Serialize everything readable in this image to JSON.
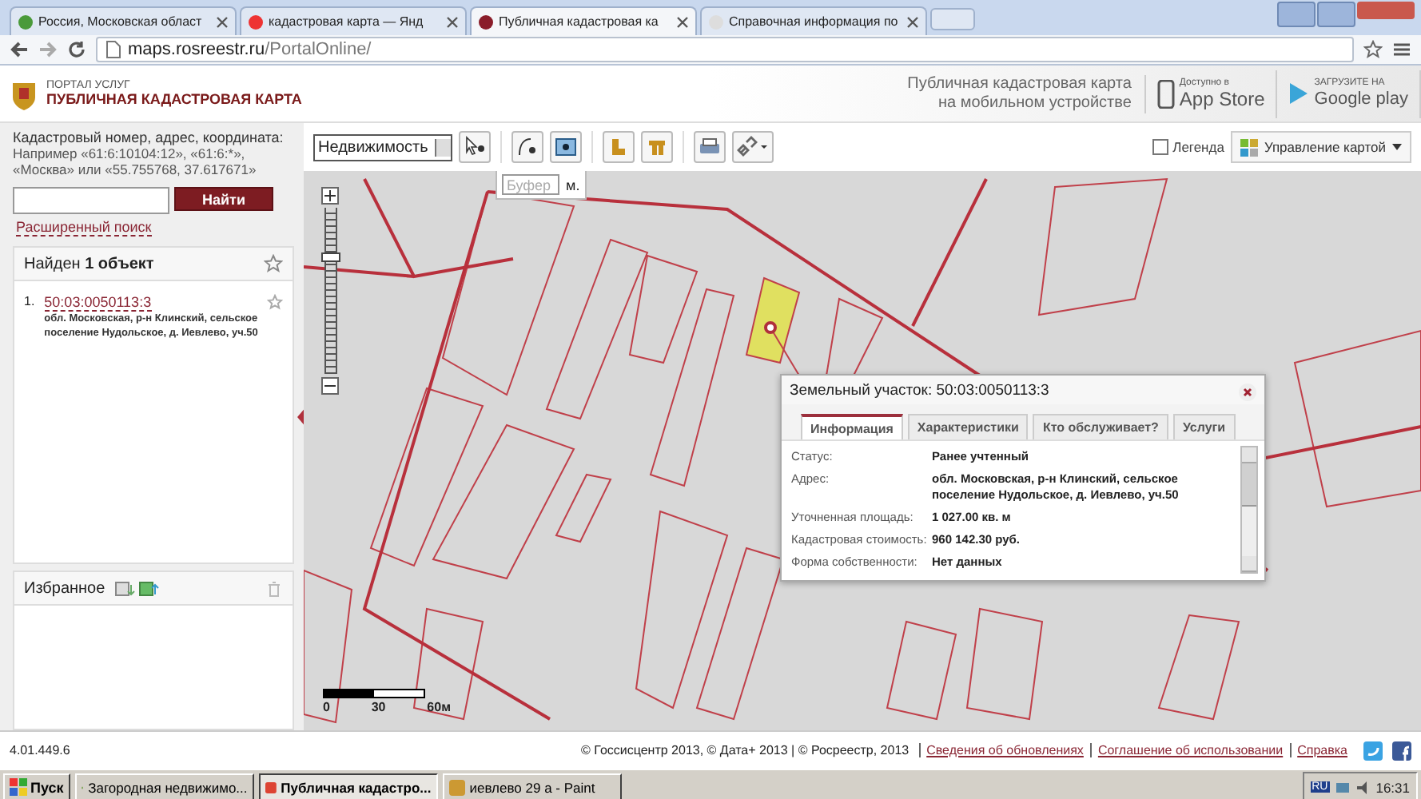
{
  "browser": {
    "tabs": [
      {
        "title": "Россия, Московская област",
        "selected": false
      },
      {
        "title": "кадастровая карта — Янд",
        "selected": false
      },
      {
        "title": "Публичная кадастровая ка",
        "selected": true
      },
      {
        "title": "Справочная информация по",
        "selected": false
      }
    ],
    "url_host": "maps.rosreestr.ru",
    "url_path": "/PortalOnline/"
  },
  "header": {
    "portal": "ПОРТАЛ УСЛУГ",
    "title": "ПУБЛИЧНАЯ КАДАСТРОВАЯ КАРТА",
    "promo": "Публичная кадастровая карта на мобильном устройстве",
    "app_store": {
      "caption": "Доступно в",
      "name": "App Store"
    },
    "google_play": {
      "caption": "ЗАГРУЗИТЕ НА",
      "name": "Google play"
    }
  },
  "search": {
    "label": "Кадастровый номер, адрес, координата:",
    "hint": "Например «61:6:10104:12», «61:6:*», «Москва» или «55.755768, 37.617671»",
    "button": "Найти",
    "advanced": "Расширенный поиск"
  },
  "results": {
    "heading": "Найден **1 объект**",
    "items": [
      {
        "number": "1.",
        "id": "50:03:0050113:3",
        "address": "обл. Московская, р-н Клинский, сельское поселение Нудольское, д. Иевлево, уч.50"
      }
    ]
  },
  "favorites": {
    "heading": "Избранное"
  },
  "toolbar": {
    "layer_select": "Недвижимость",
    "buffer_placeholder": "Буфер",
    "buffer_unit": "м.",
    "legend": {
      "label": "Легенда",
      "checked": false
    },
    "map_control": "Управление картой"
  },
  "map": {
    "zoom": {
      "level": 0.72
    },
    "scale": [
      "0",
      "30",
      "60м"
    ],
    "popup": {
      "title": "Земельный участок: 50:03:0050113:3",
      "tabs": [
        {
          "label": "Информация",
          "selected": true
        },
        {
          "label": "Характеристики",
          "selected": false
        },
        {
          "label": "Кто обслуживает?",
          "selected": false
        },
        {
          "label": "Услуги",
          "selected": false
        }
      ],
      "rows": [
        {
          "label": "Статус:",
          "value": "Ранее учтенный"
        },
        {
          "label": "Адрес:",
          "value": "обл. Московская, р-н Клинский, сельское поселение Нудольское, д. Иевлево, уч.50"
        },
        {
          "label": "Уточненная площадь:",
          "value": "1 027.00 кв. м"
        },
        {
          "label": "Кадастровая стоимость:",
          "value": "960 142.30 руб."
        },
        {
          "label": "Форма собственности:",
          "value": "Нет данных"
        }
      ]
    }
  },
  "footer": {
    "version": "4.01.449.6",
    "copyright": "© Госсисцентр 2013, © Дата+ 2013 | © Росреестр, 2013",
    "links": [
      "Сведения об обновлениях",
      "Соглашение об использовании",
      "Справка"
    ]
  },
  "taskbar": {
    "start": "Пуск",
    "items": [
      {
        "title": "Загородная недвижимо...",
        "selected": false
      },
      {
        "title": "Публичная кадастро...",
        "selected": true
      },
      {
        "title": "иевлево 29 а - Paint",
        "selected": false
      }
    ],
    "language": "RU",
    "clock": "16:31"
  }
}
